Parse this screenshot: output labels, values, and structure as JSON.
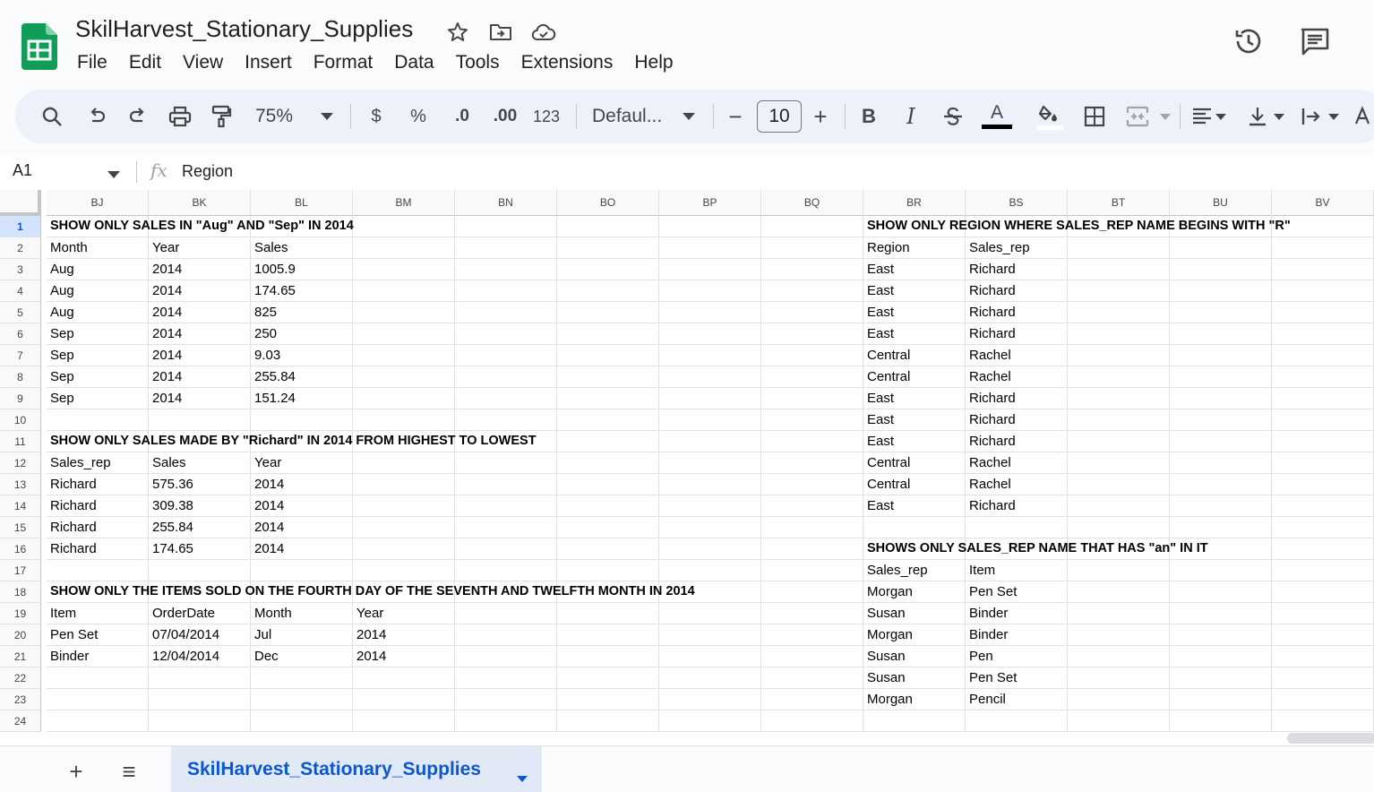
{
  "app": {
    "title": "SkilHarvest_Stationary_Supplies",
    "menu": [
      "File",
      "Edit",
      "View",
      "Insert",
      "Format",
      "Data",
      "Tools",
      "Extensions",
      "Help"
    ]
  },
  "toolbar": {
    "zoom": "75%",
    "currency": "$",
    "percent": "%",
    "dec_decrease": ".0",
    "dec_increase": ".00",
    "number_format": "123",
    "font": "Defaul...",
    "minus": "−",
    "font_size": "10",
    "plus": "+",
    "bold": "B",
    "italic": "I",
    "text_color": "A",
    "text_color_hex": "#000000"
  },
  "formula_bar": {
    "cell_ref": "A1",
    "fx": "fx",
    "value": "Region"
  },
  "grid": {
    "columns": [
      "BJ",
      "BK",
      "BL",
      "BM",
      "BN",
      "BO",
      "BP",
      "BQ",
      "BR",
      "BS",
      "BT",
      "BU",
      "BV"
    ],
    "rows": [
      "1",
      "2",
      "3",
      "4",
      "5",
      "6",
      "7",
      "8",
      "9",
      "10",
      "11",
      "12",
      "13",
      "14",
      "15",
      "16",
      "17",
      "18",
      "19",
      "20",
      "21",
      "22",
      "23",
      "24"
    ],
    "active_row": "1",
    "cells": [
      [
        "SHOW ONLY SALES IN \"Aug\" AND \"Sep\" IN 2014",
        "",
        "",
        "",
        "",
        "",
        "",
        "",
        "SHOW ONLY REGION WHERE SALES_REP NAME BEGINS WITH \"R\"",
        "",
        "",
        "",
        ""
      ],
      [
        "Month",
        "Year",
        "Sales",
        "",
        "",
        "",
        "",
        "",
        "Region",
        "Sales_rep",
        "",
        "",
        ""
      ],
      [
        "Aug",
        "2014",
        "1005.9",
        "",
        "",
        "",
        "",
        "",
        "East",
        "Richard",
        "",
        "",
        ""
      ],
      [
        "Aug",
        "2014",
        "174.65",
        "",
        "",
        "",
        "",
        "",
        "East",
        "Richard",
        "",
        "",
        ""
      ],
      [
        "Aug",
        "2014",
        "825",
        "",
        "",
        "",
        "",
        "",
        "East",
        "Richard",
        "",
        "",
        ""
      ],
      [
        "Sep",
        "2014",
        "250",
        "",
        "",
        "",
        "",
        "",
        "East",
        "Richard",
        "",
        "",
        ""
      ],
      [
        "Sep",
        "2014",
        "9.03",
        "",
        "",
        "",
        "",
        "",
        "Central",
        "Rachel",
        "",
        "",
        ""
      ],
      [
        "Sep",
        "2014",
        "255.84",
        "",
        "",
        "",
        "",
        "",
        "Central",
        "Rachel",
        "",
        "",
        ""
      ],
      [
        "Sep",
        "2014",
        "151.24",
        "",
        "",
        "",
        "",
        "",
        "East",
        "Richard",
        "",
        "",
        ""
      ],
      [
        "",
        "",
        "",
        "",
        "",
        "",
        "",
        "",
        "East",
        "Richard",
        "",
        "",
        ""
      ],
      [
        "SHOW ONLY SALES MADE BY \"Richard\" IN 2014 FROM HIGHEST TO LOWEST",
        "",
        "",
        "",
        "",
        "",
        "",
        "",
        "East",
        "Richard",
        "",
        "",
        ""
      ],
      [
        "Sales_rep",
        "Sales",
        "Year",
        "",
        "",
        "",
        "",
        "",
        "Central",
        "Rachel",
        "",
        "",
        ""
      ],
      [
        "Richard",
        "575.36",
        "2014",
        "",
        "",
        "",
        "",
        "",
        "Central",
        "Rachel",
        "",
        "",
        ""
      ],
      [
        "Richard",
        "309.38",
        "2014",
        "",
        "",
        "",
        "",
        "",
        "East",
        "Richard",
        "",
        "",
        ""
      ],
      [
        "Richard",
        "255.84",
        "2014",
        "",
        "",
        "",
        "",
        "",
        "",
        "",
        "",
        "",
        ""
      ],
      [
        "Richard",
        "174.65",
        "2014",
        "",
        "",
        "",
        "",
        "",
        "SHOWS ONLY SALES_REP NAME THAT HAS \"an\" IN IT",
        "",
        "",
        "",
        ""
      ],
      [
        "",
        "",
        "",
        "",
        "",
        "",
        "",
        "",
        "Sales_rep",
        "Item",
        "",
        "",
        ""
      ],
      [
        "SHOW ONLY THE ITEMS SOLD ON THE FOURTH DAY OF THE SEVENTH AND TWELFTH MONTH IN 2014",
        "",
        "",
        "",
        "",
        "",
        "",
        "",
        "Morgan",
        "Pen Set",
        "",
        "",
        ""
      ],
      [
        "Item",
        "OrderDate",
        "Month",
        "Year",
        "",
        "",
        "",
        "",
        "Susan",
        "Binder",
        "",
        "",
        ""
      ],
      [
        "Pen Set",
        "07/04/2014",
        "Jul",
        "2014",
        "",
        "",
        "",
        "",
        "Morgan",
        "Binder",
        "",
        "",
        ""
      ],
      [
        "Binder",
        "12/04/2014",
        "Dec",
        "2014",
        "",
        "",
        "",
        "",
        "Susan",
        "Pen",
        "",
        "",
        ""
      ],
      [
        "",
        "",
        "",
        "",
        "",
        "",
        "",
        "",
        "Susan",
        "Pen Set",
        "",
        "",
        ""
      ],
      [
        "",
        "",
        "",
        "",
        "",
        "",
        "",
        "",
        "Morgan",
        "Pencil",
        "",
        "",
        ""
      ],
      [
        "",
        "",
        "",
        "",
        "",
        "",
        "",
        "",
        "",
        "",
        "",
        "",
        ""
      ]
    ],
    "bold_rows": [
      0,
      10,
      17
    ],
    "bold_right_rows": [
      0,
      15
    ]
  },
  "sheet_tabs": {
    "add": "+",
    "list": "≡",
    "active": "SkilHarvest_Stationary_Supplies"
  }
}
